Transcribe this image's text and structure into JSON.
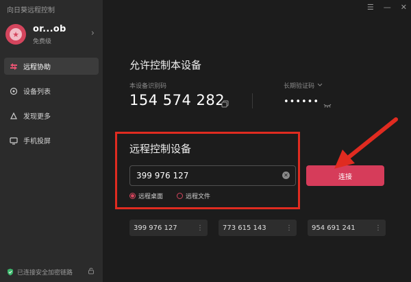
{
  "app": {
    "title": "向日葵远程控制"
  },
  "profile": {
    "name": "or...ob",
    "plan": "免费级",
    "chevron": "›"
  },
  "nav": {
    "items": [
      {
        "label": "远程协助",
        "icon": "remote-assist-icon",
        "active": true
      },
      {
        "label": "设备列表",
        "icon": "device-list-icon"
      },
      {
        "label": "发现更多",
        "icon": "discover-icon"
      },
      {
        "label": "手机投屏",
        "icon": "screen-cast-icon"
      }
    ]
  },
  "footer": {
    "status": "已连接安全加密链路"
  },
  "window": {
    "menu": "☰",
    "minimize": "—",
    "close": "✕"
  },
  "allow": {
    "title": "允许控制本设备",
    "id_label": "本设备识别码",
    "id_value": "154 574 282",
    "code_label": "长期验证码",
    "code_value": "••••••"
  },
  "remote": {
    "title": "远程控制设备",
    "input_value": "399 976 127",
    "clear": "✕",
    "options": [
      {
        "label": "远程桌面",
        "checked": true
      },
      {
        "label": "远程文件",
        "checked": false
      }
    ],
    "connect_label": "连接"
  },
  "recent": [
    {
      "id": "399 976 127"
    },
    {
      "id": "773 615 143"
    },
    {
      "id": "954 691 241"
    }
  ],
  "colors": {
    "accent": "#d63c5a",
    "highlight": "#e02b20"
  }
}
